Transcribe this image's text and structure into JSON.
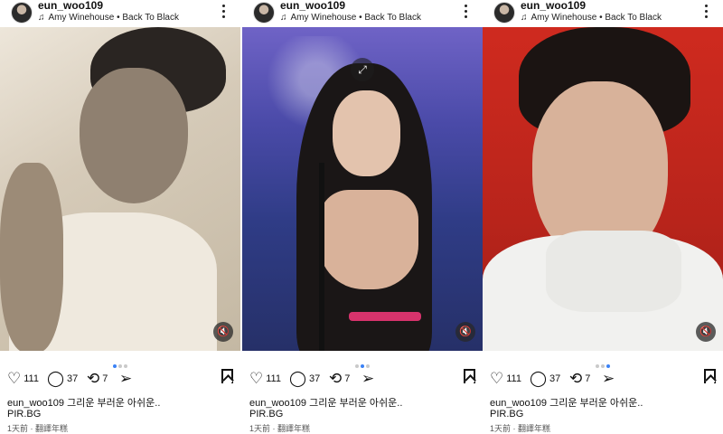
{
  "posts": [
    {
      "username": "eun_woo109",
      "song": "Amy Winehouse • Back To Black",
      "likes": "111",
      "comments": "37",
      "reposts": "7",
      "caption_user": "eun_woo109",
      "caption_text": "그리운 부러운 아쉬운..",
      "link": "PIR.BG",
      "time": "1天前",
      "translate": "翻譯年糕",
      "active_dot": 0
    },
    {
      "username": "eun_woo109",
      "song": "Amy Winehouse • Back To Black",
      "likes": "111",
      "comments": "37",
      "reposts": "7",
      "caption_user": "eun_woo109",
      "caption_text": "그리운 부러운 아쉬운..",
      "link": "PIR.BG",
      "time": "1天前",
      "translate": "翻譯年糕",
      "active_dot": 1
    },
    {
      "username": "eun_woo109",
      "song": "Amy Winehouse • Back To Black",
      "likes": "111",
      "comments": "37",
      "reposts": "7",
      "caption_user": "eun_woo109",
      "caption_text": "그리운 부러운 아쉬운..",
      "link": "PIR.BG",
      "time": "1天前",
      "translate": "翻譯年糕",
      "active_dot": 2
    }
  ],
  "icons": {
    "like": "heart-icon",
    "comment": "comment-icon",
    "repost": "repost-icon",
    "share": "share-icon",
    "save": "bookmark-icon",
    "mute": "mute-icon",
    "expand": "expand-icon",
    "music": "music-note-icon",
    "more": "more-options-icon"
  },
  "colors": {
    "accent": "#3b82f6",
    "belt": "#d6336c"
  }
}
